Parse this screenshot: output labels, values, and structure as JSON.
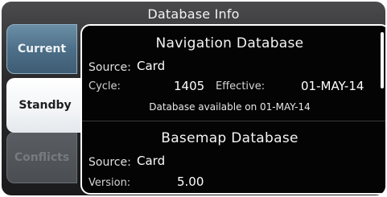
{
  "window": {
    "title": "Database Info"
  },
  "tabs": [
    {
      "label": "Current",
      "state": "inactive"
    },
    {
      "label": "Standby",
      "state": "selected"
    },
    {
      "label": "Conflicts",
      "state": "disabled"
    }
  ],
  "navigation": {
    "heading": "Navigation Database",
    "source_label": "Source:",
    "source_value": "Card",
    "cycle_label": "Cycle:",
    "cycle_value": "1405",
    "effective_label": "Effective:",
    "effective_value": "01-MAY-14",
    "availability_note": "Database available on 01-MAY-14"
  },
  "basemap": {
    "heading": "Basemap Database",
    "source_label": "Source:",
    "source_value": "Card",
    "version_label": "Version:",
    "version_value": "5.00"
  },
  "colors": {
    "accent_tab": "#4d6f88",
    "selected_tab": "#ffffff",
    "panel_background": "#040404",
    "panel_border": "#ffffff"
  }
}
